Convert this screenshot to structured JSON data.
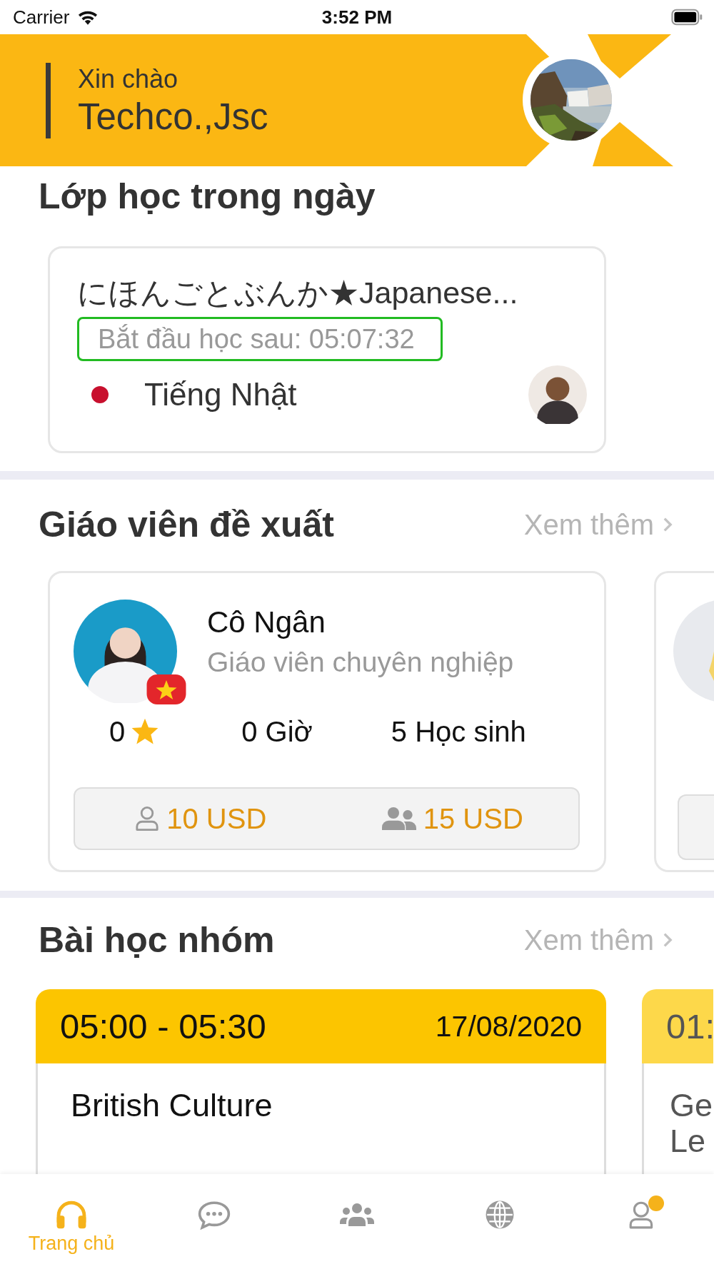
{
  "status_bar": {
    "carrier": "Carrier",
    "time": "3:52 PM"
  },
  "header": {
    "greeting": "Xin chào",
    "name": "Techco.,Jsc"
  },
  "today_classes": {
    "title": "Lớp học trong ngày",
    "items": [
      {
        "title": "にほんごとぶんか★Japanese...",
        "countdown": "Bắt đầu học sau: 05:07:32",
        "language": "Tiếng Nhật",
        "color": "#c8102e"
      }
    ]
  },
  "teachers": {
    "title": "Giáo viên đề xuất",
    "more": "Xem thêm",
    "items": [
      {
        "kind": "full",
        "name": "Cô Ngân",
        "role": "Giáo viên chuyên nghiệp",
        "rating": "0",
        "hours": "0 Giờ",
        "students": "5 Học sinh",
        "prices": [
          {
            "kind": "single",
            "price": "10 USD"
          },
          {
            "kind": "group",
            "price": "15 USD"
          }
        ]
      },
      {
        "kind": "clipped"
      }
    ]
  },
  "group_lessons": {
    "title": "Bài học nhóm",
    "more": "Xem thêm",
    "items": [
      {
        "time": "05:00 - 05:30",
        "date": "17/08/2020",
        "title_lines": [
          "British Culture"
        ],
        "dimmed": false
      },
      {
        "time": "01:",
        "title_lines": [
          "Ge",
          "Le"
        ],
        "dimmed": true
      }
    ]
  },
  "tabs": [
    {
      "kind": "headphones",
      "label": "Trang chủ",
      "selected": true,
      "badge": false
    },
    {
      "kind": "chat",
      "selected": false,
      "badge": false
    },
    {
      "kind": "group",
      "selected": false,
      "badge": false
    },
    {
      "kind": "globe",
      "selected": false,
      "badge": false
    },
    {
      "kind": "profile",
      "selected": false,
      "badge": true
    }
  ]
}
